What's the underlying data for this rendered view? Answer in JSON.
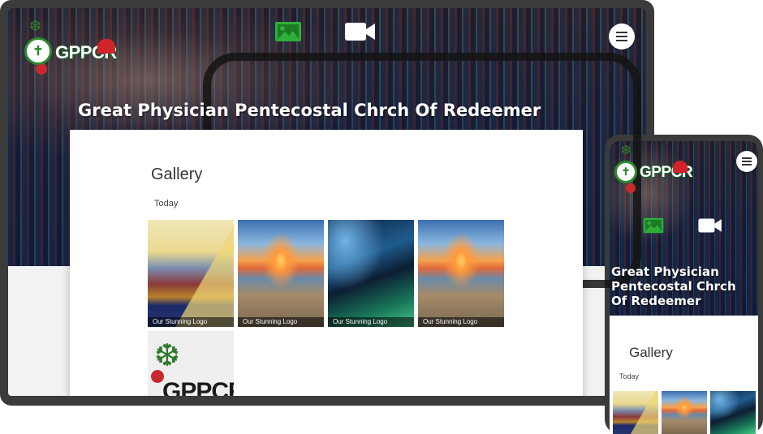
{
  "brand": {
    "wordmark": "GPPCR"
  },
  "site_title": "Great Physician Pentecostal Chrch Of Redeemer",
  "nav": {
    "icons": [
      "image-icon",
      "video-icon"
    ],
    "active_color": "#2eae3a",
    "inactive_color": "#ffffff"
  },
  "menu": {
    "icon": "hamburger-icon"
  },
  "gallery": {
    "heading": "Gallery",
    "date_group": "Today",
    "items": [
      {
        "caption": "Our Stunning Logo",
        "image": "room"
      },
      {
        "caption": "Our Stunning Logo",
        "image": "sunset"
      },
      {
        "caption": "Our Stunning Logo",
        "image": "cave"
      },
      {
        "caption": "Our Stunning Logo",
        "image": "sunset"
      },
      {
        "caption": "",
        "image": "logo"
      }
    ]
  }
}
